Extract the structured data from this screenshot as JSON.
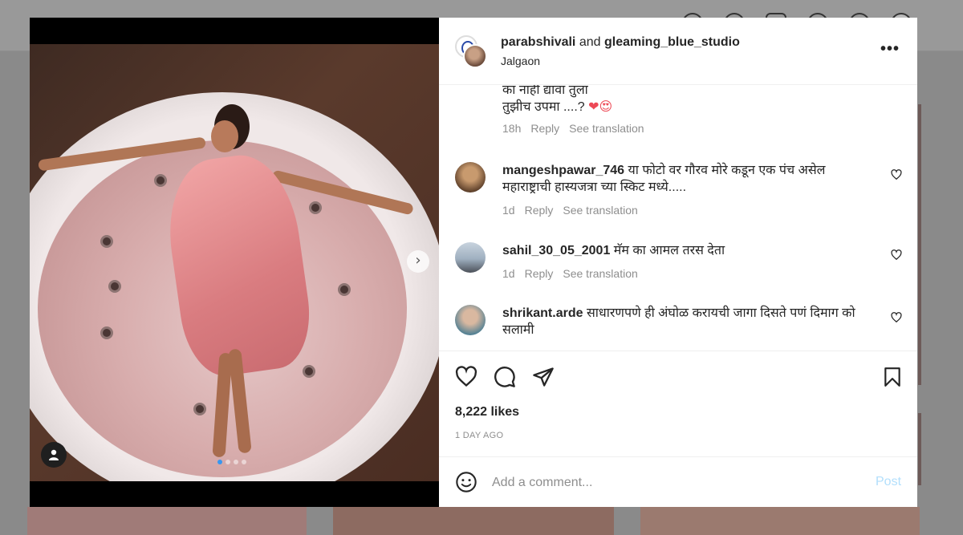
{
  "post": {
    "author_primary": "parabshivali",
    "joiner": "and",
    "author_secondary": "gleaming_blue_studio",
    "location": "Jalgaon",
    "more_glyph": "•••"
  },
  "media": {
    "slides_total": 4,
    "active_slide": 1,
    "next_glyph": "›"
  },
  "comments": [
    {
      "username": "",
      "lines": [
        "का नाही द्यावा तुला",
        "तुझीच उपमा ....?"
      ],
      "emoji": "❤😍",
      "time": "18h",
      "reply": "Reply",
      "see_translation": "See translation"
    },
    {
      "username": "mangeshpawar_746",
      "text": "या फोटो वर गौरव मोरे कडून एक पंच असेल महाराष्ट्राची हास्यजत्रा च्या स्किट मध्ये.....",
      "time": "1d",
      "reply": "Reply",
      "see_translation": "See translation"
    },
    {
      "username": "sahil_30_05_2001",
      "text": "मॅम का आमल तरस देता",
      "time": "1d",
      "reply": "Reply",
      "see_translation": "See translation"
    },
    {
      "username": "shrikant.arde",
      "text": "साधारणपणे ही अंघोळ करायची जागा दिसते पणं दिमाग को सलामी"
    }
  ],
  "actions": {
    "likes": "8,222 likes",
    "timestamp": "1 DAY AGO"
  },
  "composer": {
    "placeholder": "Add a comment...",
    "post_label": "Post"
  },
  "colors": {
    "accent_blue": "#3897f0",
    "post_disabled": "#b2dffc",
    "secondary_text": "#8e8e8e",
    "heart_red": "#ed4956"
  }
}
